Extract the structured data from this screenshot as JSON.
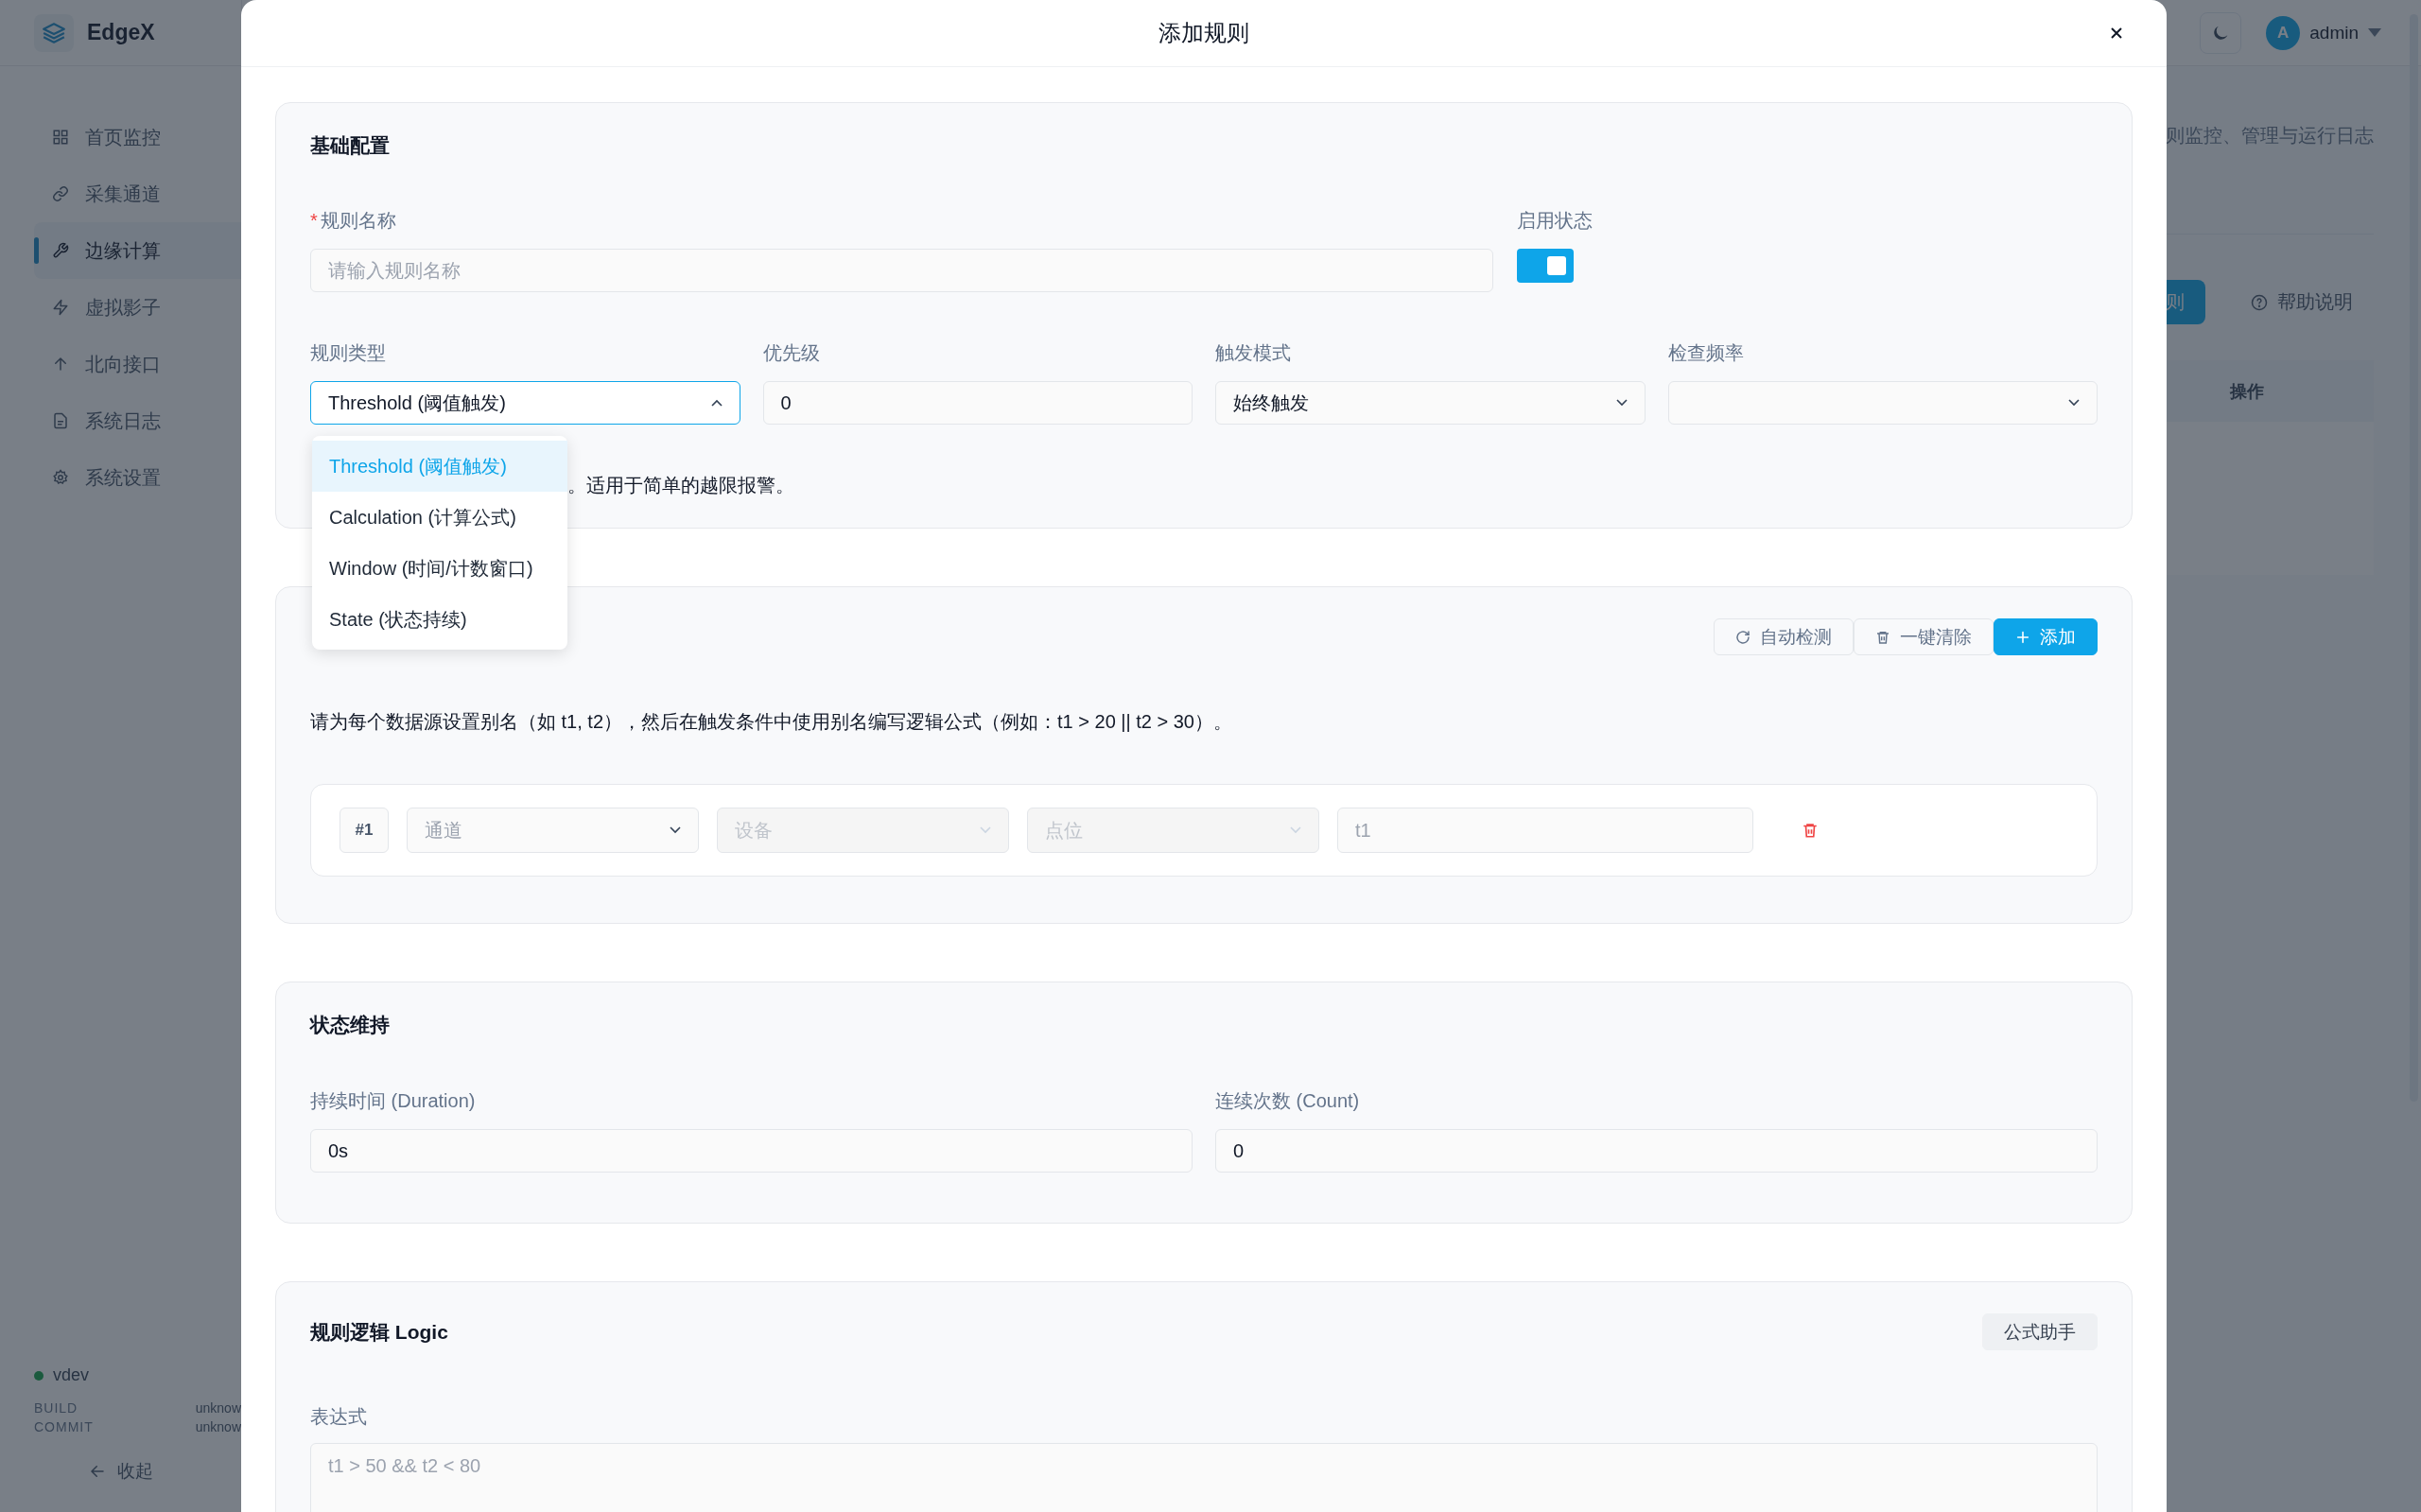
{
  "app": {
    "brand": "EdgeX",
    "nav": [
      {
        "label": "首页监控",
        "selected": false
      },
      {
        "label": "采集通道",
        "selected": false
      },
      {
        "label": "边缘计算",
        "selected": true
      },
      {
        "label": "虚拟影子",
        "selected": false
      },
      {
        "label": "北向接口",
        "selected": false
      },
      {
        "label": "系统日志",
        "selected": false
      },
      {
        "label": "系统设置",
        "selected": false
      }
    ],
    "version": "vdev",
    "build_label": "BUILD",
    "build_value": "unknow",
    "commit_label": "COMMIT",
    "commit_value": "unknow",
    "collapse": "收起",
    "user": {
      "avatar": "A",
      "name": "admin"
    },
    "page_subtitle": "则监控、管理与运行日志",
    "primary_button_fragment": "则",
    "help": "帮助说明",
    "table_header": "操作"
  },
  "modal": {
    "title": "添加规则",
    "basic": {
      "title": "基础配置",
      "name": {
        "label": "规则名称",
        "required_mark": "*",
        "placeholder": "请输入规则名称"
      },
      "enabled": {
        "label": "启用状态",
        "on": true
      },
      "rule_type": {
        "label": "规则类型",
        "value": "Threshold (阈值触发)",
        "expanded": true,
        "options": [
          {
            "label": "Threshold (阈值触发)",
            "selected": true
          },
          {
            "label": "Calculation (计算公式)",
            "selected": false
          },
          {
            "label": "Window (时间/计数窗口)",
            "selected": false
          },
          {
            "label": "State (状态持续)",
            "selected": false
          }
        ]
      },
      "priority": {
        "label": "优先级",
        "value": "0"
      },
      "trigger_mode": {
        "label": "触发模式",
        "value": "始终触发"
      },
      "check_frequency": {
        "label": "检查频率"
      },
      "hint": "。适用于简单的越限报警。"
    },
    "sources": {
      "buttons": [
        {
          "label": "自动检测",
          "kind": "refresh"
        },
        {
          "label": "一键清除",
          "kind": "clear"
        },
        {
          "label": "添加",
          "kind": "add"
        }
      ],
      "hint": "请为每个数据源设置别名（如 t1, t2），然后在触发条件中使用别名编写逻辑公式（例如：t1 > 20 || t2 > 30）。",
      "rows": [
        {
          "index": "#1",
          "selects": [
            {
              "placeholder": "通道",
              "disabled": false
            },
            {
              "placeholder": "设备",
              "disabled": true
            },
            {
              "placeholder": "点位",
              "disabled": true
            }
          ],
          "alias_placeholder": "t1"
        }
      ]
    },
    "state_hold": {
      "title": "状态维持",
      "fields": [
        {
          "label": "持续时间 (Duration)",
          "value": "0s"
        },
        {
          "label": "连续次数 (Count)",
          "value": "0"
        }
      ]
    },
    "logic": {
      "title": "规则逻辑 Logic",
      "helper_button": "公式助手",
      "expression": {
        "label": "表达式",
        "placeholder": "t1 > 50 && t2 < 80"
      }
    }
  }
}
